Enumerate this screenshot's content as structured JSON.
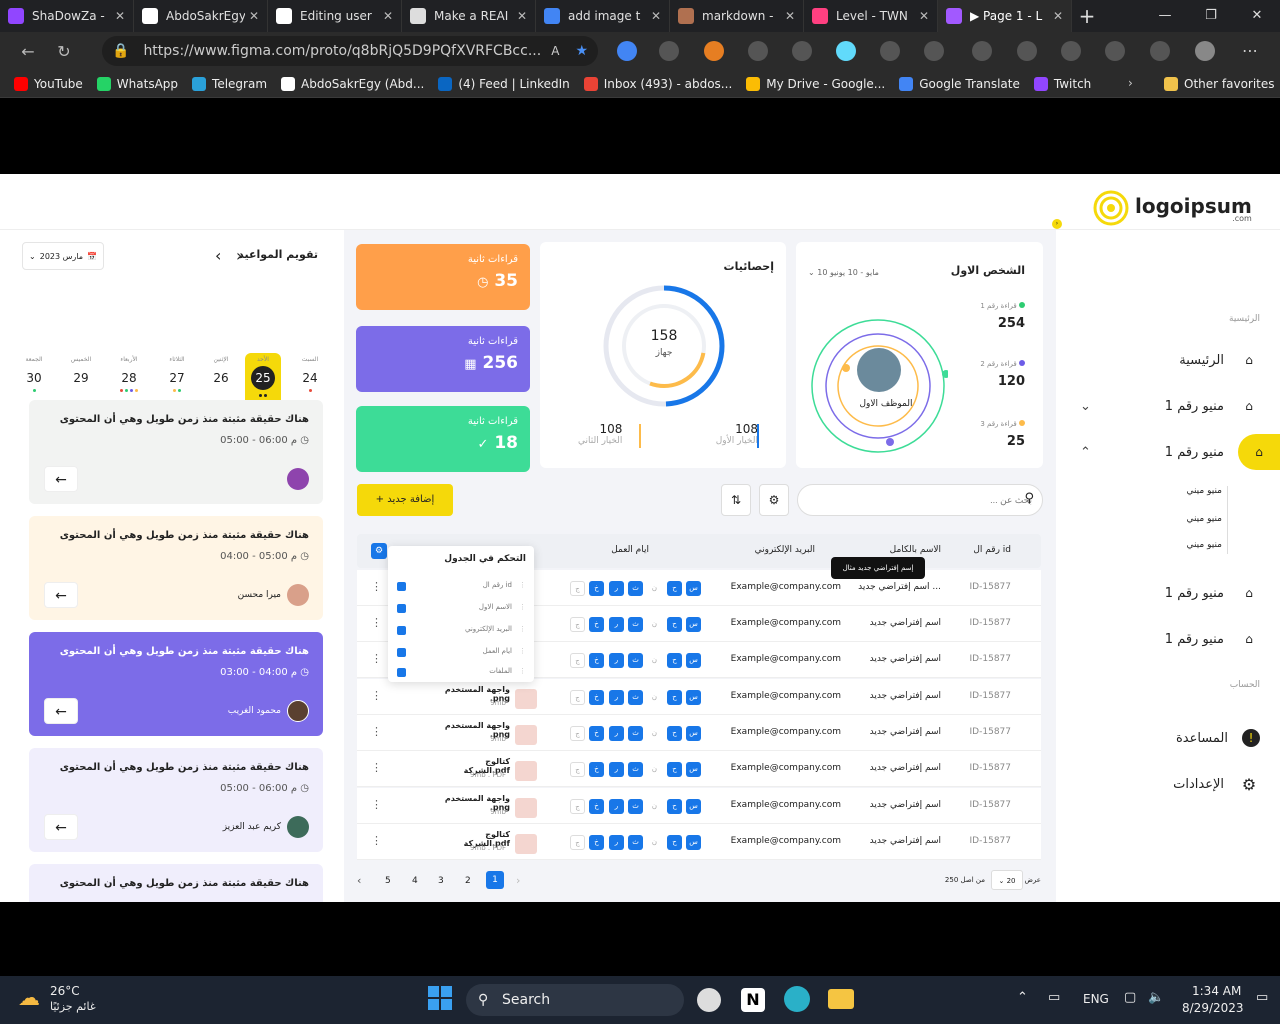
{
  "browser": {
    "tabs": [
      {
        "title": "ShaDowZa -",
        "color": "#9146ff"
      },
      {
        "title": "AbdoSakrEgy",
        "color": "#ffffff"
      },
      {
        "title": "Editing user",
        "color": "#ffffff"
      },
      {
        "title": "Make a REAI",
        "color": "#dddddd"
      },
      {
        "title": "add image t",
        "color": "#4285f4"
      },
      {
        "title": "markdown -",
        "color": "#b07050"
      },
      {
        "title": "Level - TWN",
        "color": "#ff4081"
      },
      {
        "title": "▶ Page 1 - L",
        "color": "#a259ff"
      }
    ],
    "url": "https://www.figma.com/proto/q8bRjQ5D9PQfXVRFCBcc...",
    "bookmarks": [
      {
        "label": "YouTube",
        "color": "#ff0000"
      },
      {
        "label": "WhatsApp",
        "color": "#25d366"
      },
      {
        "label": "Telegram",
        "color": "#2aa1da"
      },
      {
        "label": "AbdoSakrEgy (Abd...",
        "color": "#ffffff"
      },
      {
        "label": "(4) Feed | LinkedIn",
        "color": "#0a66c2"
      },
      {
        "label": "Inbox (493) - abdos...",
        "color": "#ea4335"
      },
      {
        "label": "My Drive - Google...",
        "color": "#fbbc04"
      },
      {
        "label": "Google Translate",
        "color": "#4285f4"
      },
      {
        "label": "Twitch",
        "color": "#9146ff"
      }
    ],
    "other_favorites": "Other favorites"
  },
  "logo": {
    "text": "logoipsum",
    "sub": ".com"
  },
  "sidebar": {
    "section_main": "الرئيسية",
    "items": [
      {
        "label": "الرئيسية",
        "icon": "home-icon"
      },
      {
        "label": "منيو رقم 1",
        "icon": "home-icon"
      },
      {
        "label": "منيو رقم 1",
        "icon": "home-icon",
        "active": true
      },
      {
        "label": "منيو رقم 1",
        "icon": "home-icon"
      },
      {
        "label": "منيو رقم 1",
        "icon": "home-icon"
      }
    ],
    "subitems": [
      "منيو ميني",
      "منيو ميني",
      "منيو ميني"
    ],
    "section_account": "الحساب",
    "help": "المساعدة",
    "settings": "الإعدادات"
  },
  "person_card": {
    "title": "الشخص الاول",
    "range": "10 مايو - 10 يونيو",
    "employee": "الموظف الاول",
    "readings": [
      {
        "label": "قراءة رقم 1",
        "value": "254",
        "color": "#2ecc71"
      },
      {
        "label": "قراءة رقم 2",
        "value": "120",
        "color": "#6c5ce7"
      },
      {
        "label": "قراءة رقم 3",
        "value": "25",
        "color": "#fdbb4a"
      }
    ]
  },
  "stats_card": {
    "title": "إحصائيات",
    "total": "158",
    "unit": "جهاز",
    "opt1_value": "108",
    "opt1_label": "الخيار الأول",
    "opt2_value": "108",
    "opt2_label": "الخيار الثاني"
  },
  "stat_tiles": [
    {
      "label": "قراءات ثانية",
      "value": "35",
      "color": "#ff9f4a",
      "icon": "clock-icon"
    },
    {
      "label": "قراءات ثانية",
      "value": "256",
      "color": "#7c6ce8",
      "icon": "calendar-icon"
    },
    {
      "label": "قراءات ثانية",
      "value": "18",
      "color": "#3ddc97",
      "icon": "check-icon"
    }
  ],
  "calendar": {
    "title": "تقويم المواعيد",
    "month": "مارس 2023",
    "days": [
      {
        "name": "الجمعة",
        "num": "30"
      },
      {
        "name": "الخميس",
        "num": "29"
      },
      {
        "name": "الأربعاء",
        "num": "28"
      },
      {
        "name": "الثلاثاء",
        "num": "27"
      },
      {
        "name": "الإثنين",
        "num": "26"
      },
      {
        "name": "الأحد",
        "num": "25"
      },
      {
        "name": "السبت",
        "num": "24"
      }
    ]
  },
  "appointments": [
    {
      "text": "هناك حقيقة مثبتة منذ زمن طويل وهي أن المحتوى",
      "time": "05:00 - 06:00 م",
      "name": "",
      "bg": "#f2f3f2"
    },
    {
      "text": "هناك حقيقة مثبتة منذ زمن طويل وهي أن المحتوى",
      "time": "04:00 - 05:00 م",
      "name": "ميرا محسن",
      "bg": "#fff5e5"
    },
    {
      "text": "هناك حقيقة مثبتة منذ زمن طويل وهي أن المحتوى",
      "time": "03:00 - 04:00 م",
      "name": "محمود الغريب",
      "bg": "#7c6ce8"
    },
    {
      "text": "هناك حقيقة مثبتة منذ زمن طويل وهي أن المحتوى",
      "time": "05:00 - 06:00 م",
      "name": "كريم عبد العزيز",
      "bg": "#f0eefc"
    },
    {
      "text": "هناك حقيقة مثبتة منذ زمن طويل وهي أن المحتوى",
      "time": "",
      "name": "",
      "bg": "#f0eefc"
    }
  ],
  "toolbar": {
    "search_placeholder": "بحث عن ...",
    "add_button": "+ إضافة جديد"
  },
  "table": {
    "headers": [
      "رقم ال id",
      "الاسم بالكامل",
      "البريد الإلكتروني",
      "ايام العمل"
    ],
    "tooltip": "إسم إفتراضي جديد مثال",
    "control_title": "التحكم في الجدول",
    "control_items": [
      "رقم ال id",
      "الاسم الاول",
      "البريد الإلكتروني",
      "ايام العمل",
      "الملفات"
    ],
    "day_letters": [
      "س",
      "ح",
      "ن",
      "ث",
      "ر",
      "خ",
      "ج"
    ],
    "rows": [
      {
        "id": "ID-15877",
        "name": "اسم إفتراضي جديد ...",
        "email": "Example@company.com",
        "file": "",
        "size": ""
      },
      {
        "id": "ID-15877",
        "name": "اسم إفتراضي جديد",
        "email": "Example@company.com",
        "file": "",
        "size": ""
      },
      {
        "id": "ID-15877",
        "name": "اسم إفتراضي جديد",
        "email": "Example@company.com",
        "file": "",
        "size": ""
      },
      {
        "id": "ID-15877",
        "name": "اسم إفتراضي جديد",
        "email": "Example@company.com",
        "file": "واجهة المستخدم .png",
        "size": "9mb"
      },
      {
        "id": "ID-15877",
        "name": "اسم إفتراضي جديد",
        "email": "Example@company.com",
        "file": "واجهة المستخدم .png",
        "size": "9mb"
      },
      {
        "id": "ID-15877",
        "name": "اسم إفتراضي جديد",
        "email": "Example@company.com",
        "file": "كتالوج الشركة.pdf",
        "size": "9mb . PDF"
      },
      {
        "id": "ID-15877",
        "name": "اسم إفتراضي جديد",
        "email": "Example@company.com",
        "file": "واجهة المستخدم .png",
        "size": "9mb"
      },
      {
        "id": "ID-15877",
        "name": "اسم إفتراضي جديد",
        "email": "Example@company.com",
        "file": "كتالوج الشركة.pdf",
        "size": "9mb . PDF"
      }
    ]
  },
  "pagination": {
    "pages": [
      "5",
      "4",
      "3",
      "2",
      "1"
    ],
    "show_label": "عرض",
    "page_size": "20",
    "total": "من اصل 250"
  },
  "taskbar": {
    "temp": "26°C",
    "weather": "غائم جزئيًا",
    "search": "Search",
    "lang": "ENG",
    "time": "1:34 AM",
    "date": "8/29/2023"
  }
}
